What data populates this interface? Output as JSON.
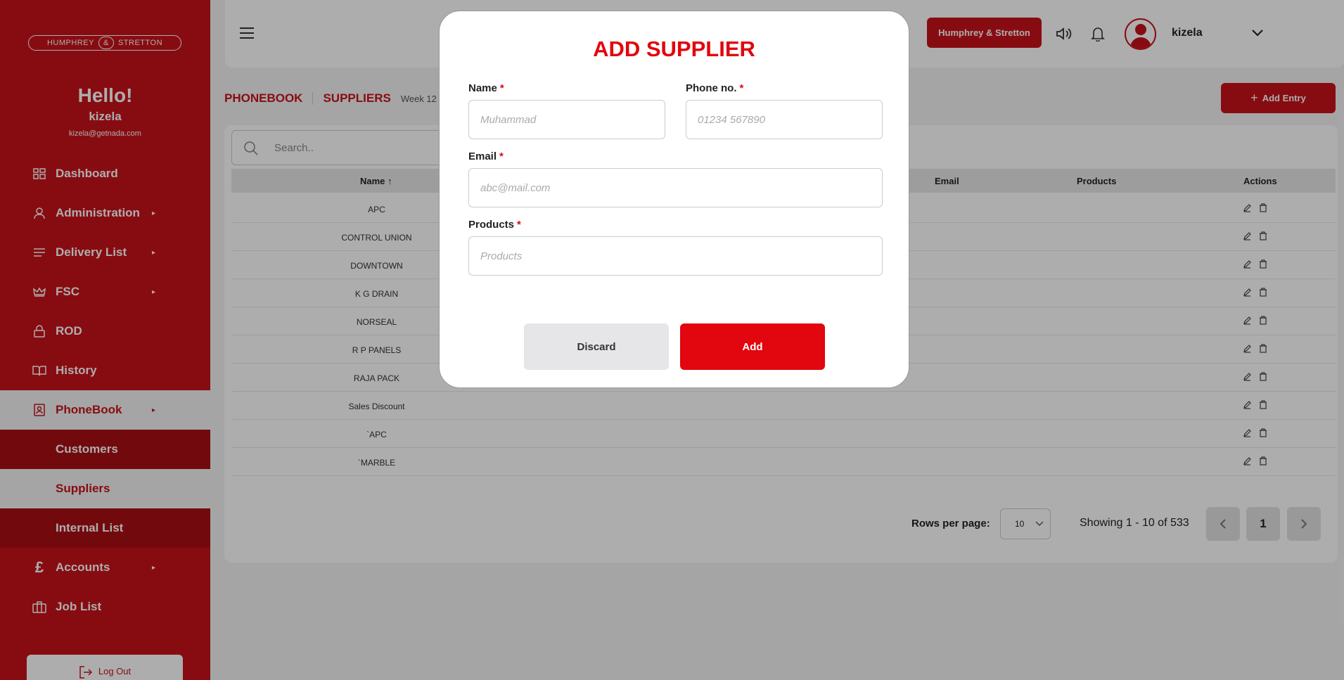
{
  "brand": {
    "logo_left": "HUMPHREY",
    "logo_amp": "&",
    "logo_right": "STRETTON",
    "company_button": "Humphrey & Stretton"
  },
  "user": {
    "greeting": "Hello!",
    "name": "kizela",
    "email": "kizela@getnada.com"
  },
  "sidebar": {
    "items": [
      {
        "label": "Dashboard"
      },
      {
        "label": "Administration"
      },
      {
        "label": "Delivery List"
      },
      {
        "label": "FSC"
      },
      {
        "label": "ROD"
      },
      {
        "label": "History"
      },
      {
        "label": "PhoneBook"
      },
      {
        "label": "Customers"
      },
      {
        "label": "Suppliers"
      },
      {
        "label": "Internal List"
      },
      {
        "label": "Accounts"
      },
      {
        "label": "Job List"
      }
    ],
    "logout": "Log Out"
  },
  "breadcrumb": {
    "level1": "PHONEBOOK",
    "level2": "SUPPLIERS",
    "week": "Week 12"
  },
  "toolbar": {
    "add_entry": "Add Entry",
    "search_placeholder": "Search.."
  },
  "table": {
    "headers": {
      "name": "Name",
      "email": "Email",
      "products": "Products",
      "actions": "Actions"
    },
    "rows": [
      "APC",
      "CONTROL UNION",
      "DOWNTOWN",
      "K G DRAIN",
      "NORSEAL",
      "R P PANELS",
      "RAJA PACK",
      "Sales Discount",
      "`APC",
      "`MARBLE"
    ]
  },
  "pagination": {
    "rows_per_page_label": "Rows per page:",
    "rows_per_page_value": "10",
    "showing": "Showing 1 - 10 of 533",
    "current_page": "1"
  },
  "modal": {
    "title": "ADD SUPPLIER",
    "name_label": "Name",
    "name_placeholder": "Muhammad",
    "phone_label": "Phone no.",
    "phone_placeholder": "01234 567890",
    "email_label": "Email",
    "email_placeholder": "abc@mail.com",
    "products_label": "Products",
    "products_placeholder": "Products",
    "required_mark": "*",
    "discard": "Discard",
    "add": "Add"
  },
  "colors": {
    "brand_red": "#c8131a",
    "modal_red": "#e2060f"
  }
}
